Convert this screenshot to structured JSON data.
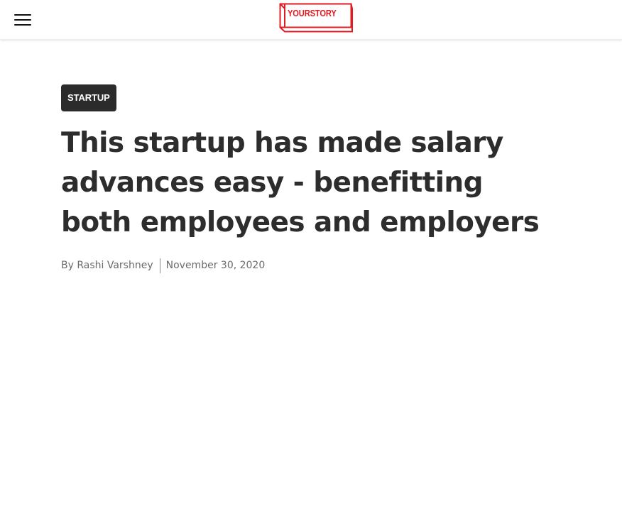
{
  "header": {
    "menu_icon": "hamburger-menu-icon",
    "logo_text": "YOURSTORY",
    "brand_color": "#e21b23"
  },
  "article": {
    "category": "STARTUP",
    "title": "This startup has made salary advances easy - benefitting both employees and employers",
    "byline_prefix": "By",
    "author": "Rashi Varshney",
    "date": "November 30, 2020"
  }
}
